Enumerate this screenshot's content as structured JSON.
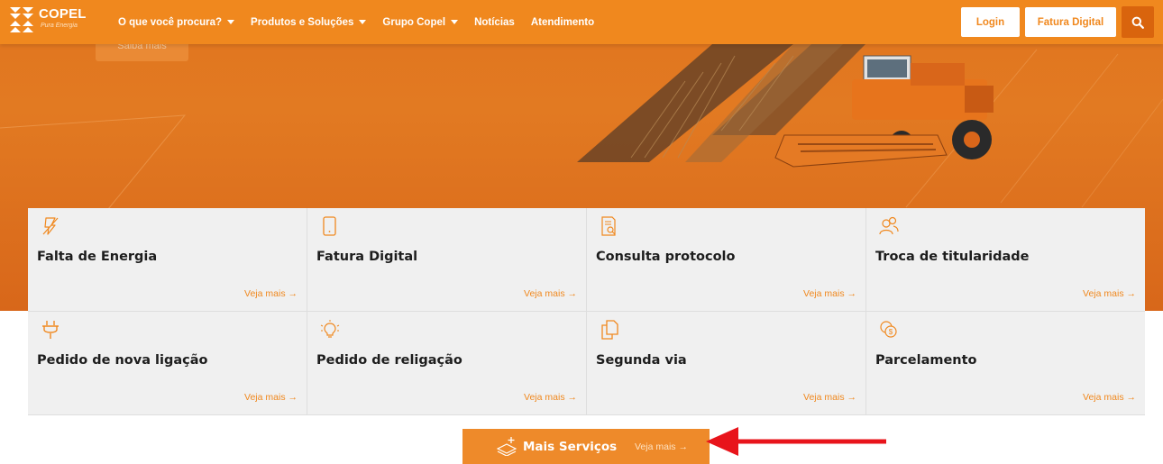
{
  "header": {
    "logo_name": "COPEL",
    "logo_tagline": "Pura Energia",
    "nav": [
      {
        "label": "O que você procura?",
        "has_dropdown": true
      },
      {
        "label": "Produtos e Soluções",
        "has_dropdown": true
      },
      {
        "label": "Grupo Copel",
        "has_dropdown": true
      },
      {
        "label": "Notícias",
        "has_dropdown": false
      },
      {
        "label": "Atendimento",
        "has_dropdown": false
      }
    ],
    "login_label": "Login",
    "fatura_label": "Fatura Digital",
    "search_icon": "search-icon"
  },
  "hero": {
    "cta_label": "Saiba mais"
  },
  "services": [
    {
      "title": "Falta de Energia",
      "icon": "lightning-off-icon",
      "more": "Veja mais →"
    },
    {
      "title": "Fatura Digital",
      "icon": "smartphone-icon",
      "more": "Veja mais →"
    },
    {
      "title": "Consulta protocolo",
      "icon": "document-search-icon",
      "more": "Veja mais →"
    },
    {
      "title": "Troca de titularidade",
      "icon": "users-icon",
      "more": "Veja mais →"
    },
    {
      "title": "Pedido de nova ligação",
      "icon": "plug-icon",
      "more": "Veja mais →"
    },
    {
      "title": "Pedido de religação",
      "icon": "lightbulb-icon",
      "more": "Veja mais →"
    },
    {
      "title": "Segunda via",
      "icon": "copy-document-icon",
      "more": "Veja mais →"
    },
    {
      "title": "Parcelamento",
      "icon": "coins-icon",
      "more": "Veja mais →"
    }
  ],
  "mais_servicos": {
    "label": "Mais Serviços",
    "more": "Veja mais →"
  },
  "colors": {
    "brand_orange": "#f0881e",
    "hero_orange": "#e0741e",
    "search_button": "#d9640d",
    "card_bg": "#f0f0f0",
    "annotation_red": "#e8141b"
  }
}
